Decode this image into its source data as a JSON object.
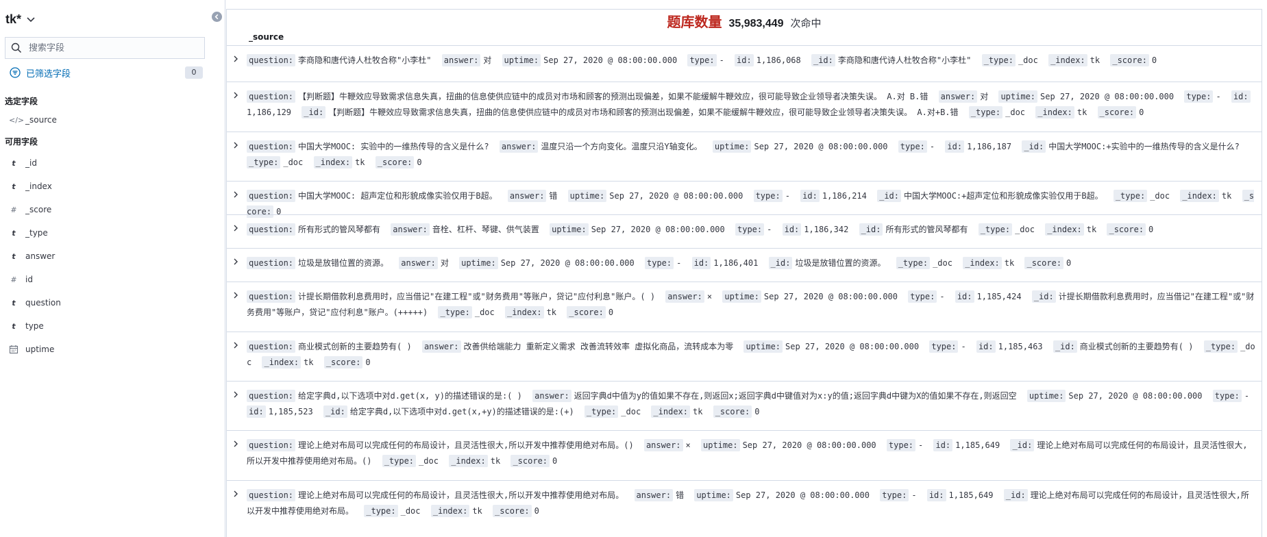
{
  "sidebar": {
    "index_pattern": "tk*",
    "search_placeholder": "搜索字段",
    "filter_label": "已筛选字段",
    "filter_count": "0",
    "selected_title": "选定字段",
    "selected_fields": [
      {
        "type_icon": "code",
        "name": "_source"
      }
    ],
    "available_title": "可用字段",
    "available_fields": [
      {
        "type_icon": "t",
        "name": "_id"
      },
      {
        "type_icon": "t",
        "name": "_index"
      },
      {
        "type_icon": "#",
        "name": "_score"
      },
      {
        "type_icon": "t",
        "name": "_type"
      },
      {
        "type_icon": "t",
        "name": "answer"
      },
      {
        "type_icon": "#",
        "name": "id"
      },
      {
        "type_icon": "t",
        "name": "question"
      },
      {
        "type_icon": "t",
        "name": "type"
      },
      {
        "type_icon": "calendar",
        "name": "uptime"
      }
    ]
  },
  "main": {
    "hits_label": "题库数量",
    "hits_count": "35,983,449",
    "hits_suffix": "次命中",
    "column_header": "_source",
    "rows": [
      {
        "question": "李商隐和唐代诗人杜牧合称\"小李杜\"",
        "answer": "对",
        "uptime": "Sep 27, 2020 @ 08:00:00.000",
        "type": "-",
        "id": "1,186,068",
        "_id": "李商隐和唐代诗人杜牧合称\"小李杜\"",
        "_type": "_doc",
        "_index": "tk",
        "_score": "0"
      },
      {
        "question": "【判断题】牛鞭效应导致需求信息失真，扭曲的信息使供应链中的成员对市场和顾客的预测出现偏差，如果不能缓解牛鞭效应，很可能导致企业领导者决策失误。 A.对 B.错",
        "answer": "对",
        "uptime": "Sep 27, 2020 @ 08:00:00.000",
        "type": "-",
        "id": "1,186,129",
        "_id": "【判断题】牛鞭效应导致需求信息失真，扭曲的信息使供应链中的成员对市场和顾客的预测出现偏差，如果不能缓解牛鞭效应，很可能导致企业领导者决策失误。 A.对+B.错",
        "_type": "_doc",
        "_index": "tk",
        "_score": "0"
      },
      {
        "question": "中国大学MOOC: 实验中的一维热传导的含义是什么?",
        "answer": "温度只沿一个方向变化。温度只沿Y轴变化。",
        "uptime": "Sep 27, 2020 @ 08:00:00.000",
        "type": "-",
        "id": "1,186,187",
        "_id": "中国大学MOOC:+实验中的一维热传导的含义是什么?",
        "_type": "_doc",
        "_index": "tk",
        "_score": "0"
      },
      {
        "question": "中国大学MOOC: 超声定位和形貌成像实验仅用于B超。",
        "answer": "错",
        "uptime": "Sep 27, 2020 @ 08:00:00.000",
        "type": "-",
        "id": "1,186,214",
        "_id": "中国大学MOOC:+超声定位和形貌成像实验仅用于B超。",
        "_type": "_doc",
        "_index": "tk",
        "_score": "0"
      },
      {
        "question": "所有形式的管风琴都有",
        "answer": "音栓、杠杆、琴键、供气装置",
        "uptime": "Sep 27, 2020 @ 08:00:00.000",
        "type": "-",
        "id": "1,186,342",
        "_id": "所有形式的管风琴都有",
        "_type": "_doc",
        "_index": "tk",
        "_score": "0"
      },
      {
        "question": "垃圾是放错位置的资源。",
        "answer": "对",
        "uptime": "Sep 27, 2020 @ 08:00:00.000",
        "type": "-",
        "id": "1,186,401",
        "_id": "垃圾是放错位置的资源。",
        "_type": "_doc",
        "_index": "tk",
        "_score": "0"
      },
      {
        "question": "计提长期借款利息费用时，应当借记\"在建工程\"或\"财务费用\"等账户，贷记\"应付利息\"账户。( )",
        "answer": "×",
        "uptime": "Sep 27, 2020 @ 08:00:00.000",
        "type": "-",
        "id": "1,185,424",
        "_id": "计提长期借款利息费用时，应当借记\"在建工程\"或\"财务费用\"等账户，贷记\"应付利息\"账户。(+++++)",
        "_type": "_doc",
        "_index": "tk",
        "_score": "0"
      },
      {
        "question": "商业模式创新的主要趋势有( )",
        "answer": "改善供给端能力 重新定义需求 改善流转效率 虚拟化商品，流转成本为零",
        "uptime": "Sep 27, 2020 @ 08:00:00.000",
        "type": "-",
        "id": "1,185,463",
        "_id": "商业模式创新的主要趋势有( )",
        "_type": "_doc",
        "_index": "tk",
        "_score": "0"
      },
      {
        "question": "给定字典d,以下选项中对d.get(x, y)的描述错误的是:( )",
        "answer": "返回字典d中值为y的值如果不存在,则返回x;返回字典d中键值对为x:y的值;返回字典d中键为X的值如果不存在,则返回空",
        "uptime": "Sep 27, 2020 @ 08:00:00.000",
        "type": "-",
        "id": "1,185,523",
        "_id": "给定字典d,以下选项中对d.get(x,+y)的描述错误的是:(+)",
        "_type": "_doc",
        "_index": "tk",
        "_score": "0"
      },
      {
        "question": "理论上绝对布局可以完成任何的布局设计，且灵活性很大,所以开发中推荐使用绝对布局。()",
        "answer": "×",
        "uptime": "Sep 27, 2020 @ 08:00:00.000",
        "type": "-",
        "id": "1,185,649",
        "_id": "理论上绝对布局可以完成任何的布局设计，且灵活性很大,所以开发中推荐使用绝对布局。()",
        "_type": "_doc",
        "_index": "tk",
        "_score": "0"
      },
      {
        "question": "理论上绝对布局可以完成任何的布局设计，且灵活性很大,所以开发中推荐使用绝对布局。",
        "answer": "错",
        "uptime": "Sep 27, 2020 @ 08:00:00.000",
        "type": "-",
        "id": "1,185,649",
        "_id": "理论上绝对布局可以完成任何的布局设计，且灵活性很大,所以开发中推荐使用绝对布局。",
        "_type": "_doc",
        "_index": "tk",
        "_score": "0"
      }
    ]
  }
}
